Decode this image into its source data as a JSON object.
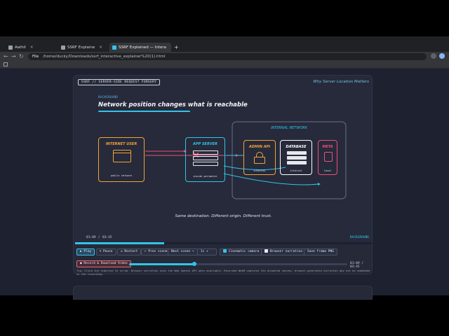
{
  "browser": {
    "tabs": [
      {
        "label": "Aathil",
        "active": false
      },
      {
        "label": "SSRF Explaine",
        "active": false
      },
      {
        "label": "SSRF Explained — Intera",
        "active": true
      }
    ],
    "new_tab": "+",
    "url_scheme": "File",
    "url": "/home/ducky/Downloads/ssrf_interactive_explainer%20(1).html"
  },
  "stage": {
    "series_tag": "SSRF // SERVER-SIDE REQUEST FORGERY",
    "why": "Why Server Location Matters",
    "section_tag": "BACKGROUND",
    "headline": "Network position changes what is reachable",
    "internal_label": "INTERNAL NETWORK",
    "nodes": {
      "user": {
        "title": "INTERNET USER",
        "sub": "public network"
      },
      "app": {
        "title": "APP SERVER",
        "sub": "inside perimeter"
      },
      "admin": {
        "title": "ADMIN API",
        "sub": "internal"
      },
      "db": {
        "title": "DATABASE",
        "sub": "internal"
      },
      "meta": {
        "title": "META",
        "sub": "local"
      }
    },
    "caption": "Same destination. Different origin. Different trust."
  },
  "player": {
    "time": "01:09",
    "sep": "/",
    "duration": "03:45",
    "scene": "BACKGROUND",
    "progress": 0.3,
    "buttons": {
      "play": "▶ Play",
      "pause": "⏸ Pause",
      "restart": "↺ Restart",
      "prev": "← Prev scene",
      "next": "Next scene →",
      "speed": "1×",
      "cinematic": "Cinematic camera",
      "narration": "Browser narration",
      "save": "Save frame PNG",
      "record": "● Record & Download Video"
    },
    "cinematic_on": true,
    "narration_on": false,
    "scrub_time": "01:09 / 03:45",
    "tip": "Tip: Click the timeline to scrub. Browser narration uses the Web Speech API when available. Recorded WebM captures the animated canvas; browser-generated narration may not be embedded in the recording."
  },
  "colors": {
    "accent": "#33c4ea",
    "user": "#f2a33a",
    "app": "#33c4ea",
    "admin": "#f2a33a",
    "db": "#ffffff",
    "meta": "#ee4f7a",
    "blocked": "#ee4f7a"
  }
}
